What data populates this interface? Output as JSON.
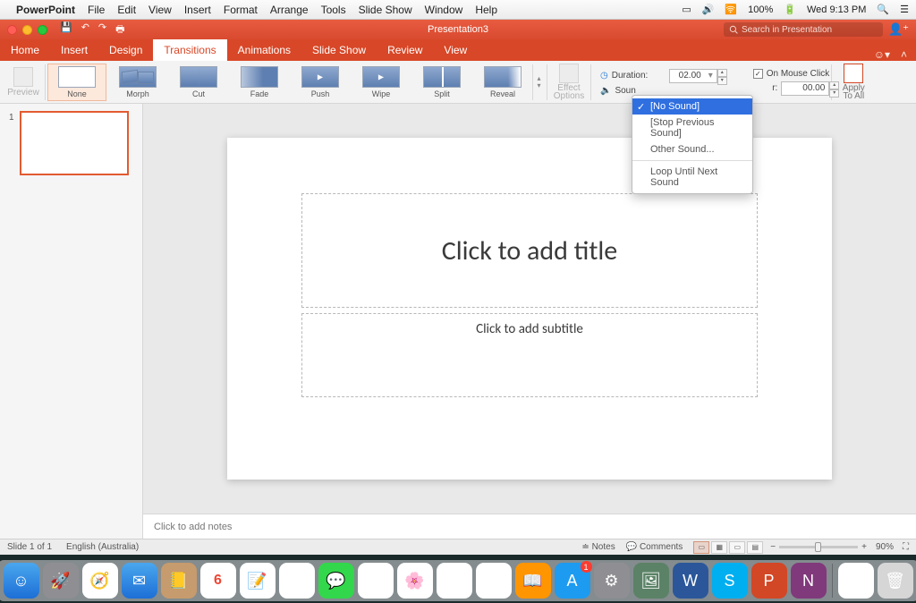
{
  "menubar": {
    "app": "PowerPoint",
    "items": [
      "File",
      "Edit",
      "View",
      "Insert",
      "Format",
      "Arrange",
      "Tools",
      "Slide Show",
      "Window",
      "Help"
    ],
    "right": {
      "battery": "100%",
      "clock": "Wed 9:13 PM"
    }
  },
  "window": {
    "title": "Presentation3",
    "search_placeholder": "Search in Presentation"
  },
  "tabs": [
    "Home",
    "Insert",
    "Design",
    "Transitions",
    "Animations",
    "Slide Show",
    "Review",
    "View"
  ],
  "active_tab": "Transitions",
  "ribbon": {
    "preview": "Preview",
    "transitions": [
      {
        "name": "None",
        "variant": "tv-none",
        "selected": true
      },
      {
        "name": "Morph",
        "variant": "tv-morph"
      },
      {
        "name": "Cut",
        "variant": "tv-cut"
      },
      {
        "name": "Fade",
        "variant": "tv-fade"
      },
      {
        "name": "Push",
        "variant": "tv-push"
      },
      {
        "name": "Wipe",
        "variant": "tv-wipe"
      },
      {
        "name": "Split",
        "variant": "tv-split"
      },
      {
        "name": "Reveal",
        "variant": "tv-reveal"
      }
    ],
    "effect_options": "Effect\nOptions",
    "duration_label": "Duration:",
    "duration_value": "02.00",
    "on_mouse_click": "On Mouse Click",
    "sound_label": "Soun",
    "after_r": "r:",
    "after_value": "00.00",
    "apply_all": "Apply\nTo All"
  },
  "sound_menu": {
    "items": [
      "[No Sound]",
      "[Stop Previous Sound]",
      "Other Sound..."
    ],
    "loop": "Loop Until Next Sound",
    "selected": "[No Sound]"
  },
  "thumb": {
    "num": "1"
  },
  "slide": {
    "title_ph": "Click to add title",
    "subtitle_ph": "Click to add subtitle"
  },
  "notes_ph": "Click to add notes",
  "status": {
    "slide": "Slide 1 of 1",
    "lang": "English (Australia)",
    "notes": "Notes",
    "comments": "Comments",
    "zoom": "90%"
  },
  "dock": [
    {
      "name": "finder",
      "bg": "linear-gradient(#4aa7ee,#1d6fd6)",
      "glyph": "☺"
    },
    {
      "name": "launchpad",
      "bg": "#8e8e93",
      "glyph": "🚀"
    },
    {
      "name": "safari",
      "bg": "#fff",
      "glyph": "🧭"
    },
    {
      "name": "mail",
      "bg": "linear-gradient(#4aa7ee,#1d6fd6)",
      "glyph": "✉"
    },
    {
      "name": "contacts",
      "bg": "#c69b6d",
      "glyph": "📒"
    },
    {
      "name": "calendar",
      "bg": "#fff",
      "glyph": "6"
    },
    {
      "name": "notes",
      "bg": "#fff",
      "glyph": "📝"
    },
    {
      "name": "reminders",
      "bg": "#fff",
      "glyph": "☑"
    },
    {
      "name": "messages",
      "bg": "#32d74b",
      "glyph": "💬"
    },
    {
      "name": "maps",
      "bg": "#fff",
      "glyph": "🗺"
    },
    {
      "name": "photos",
      "bg": "#fff",
      "glyph": "🌸"
    },
    {
      "name": "itunes",
      "bg": "#fff",
      "glyph": "♫"
    },
    {
      "name": "chrome",
      "bg": "#fff",
      "glyph": "◎"
    },
    {
      "name": "ibooks",
      "bg": "#ff9500",
      "glyph": "📖"
    },
    {
      "name": "appstore",
      "bg": "#1d9bf0",
      "glyph": "A",
      "badge": true
    },
    {
      "name": "preferences",
      "bg": "#8e8e93",
      "glyph": "⚙"
    },
    {
      "name": "preview",
      "bg": "#5b8266",
      "glyph": "🖼"
    },
    {
      "name": "word",
      "bg": "#2b579a",
      "glyph": "W"
    },
    {
      "name": "skype",
      "bg": "#00aff0",
      "glyph": "S"
    },
    {
      "name": "powerpoint",
      "bg": "#d24726",
      "glyph": "P"
    },
    {
      "name": "onenote",
      "bg": "#80397b",
      "glyph": "N"
    }
  ],
  "dock_right": [
    {
      "name": "printer",
      "bg": "#fff",
      "glyph": "🖨"
    },
    {
      "name": "trash",
      "bg": "#d6d6d6",
      "glyph": "🗑"
    }
  ]
}
